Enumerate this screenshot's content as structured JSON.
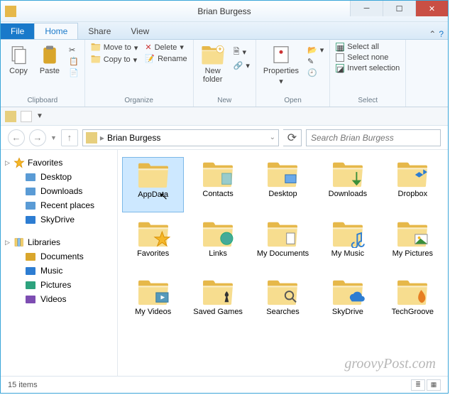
{
  "window": {
    "title": "Brian Burgess"
  },
  "tabs": {
    "file": "File",
    "items": [
      "Home",
      "Share",
      "View"
    ],
    "active": 0
  },
  "ribbon": {
    "clipboard": {
      "label": "Clipboard",
      "copy": "Copy",
      "paste": "Paste"
    },
    "organize": {
      "label": "Organize",
      "moveto": "Move to",
      "copyto": "Copy to",
      "delete": "Delete",
      "rename": "Rename"
    },
    "new": {
      "label": "New",
      "newfolder": "New\nfolder"
    },
    "open": {
      "label": "Open",
      "properties": "Properties"
    },
    "select": {
      "label": "Select",
      "all": "Select all",
      "none": "Select none",
      "invert": "Invert selection"
    }
  },
  "address": {
    "path": "Brian Burgess",
    "search_placeholder": "Search Brian Burgess"
  },
  "sidebar": {
    "favorites": {
      "label": "Favorites",
      "items": [
        "Desktop",
        "Downloads",
        "Recent places",
        "SkyDrive"
      ]
    },
    "libraries": {
      "label": "Libraries",
      "items": [
        "Documents",
        "Music",
        "Pictures",
        "Videos"
      ]
    }
  },
  "files": [
    {
      "name": "AppData",
      "selected": true,
      "badge": ""
    },
    {
      "name": "Contacts",
      "badge": "contacts"
    },
    {
      "name": "Desktop",
      "badge": "desktop"
    },
    {
      "name": "Downloads",
      "badge": "down"
    },
    {
      "name": "Dropbox",
      "badge": "dropbox"
    },
    {
      "name": "Favorites",
      "badge": "star"
    },
    {
      "name": "Links",
      "badge": "globe"
    },
    {
      "name": "My Documents",
      "badge": "doc"
    },
    {
      "name": "My Music",
      "badge": "music"
    },
    {
      "name": "My Pictures",
      "badge": "pic"
    },
    {
      "name": "My Videos",
      "badge": "video"
    },
    {
      "name": "Saved Games",
      "badge": "chess"
    },
    {
      "name": "Searches",
      "badge": "search"
    },
    {
      "name": "SkyDrive",
      "badge": "cloud"
    },
    {
      "name": "TechGroove",
      "badge": "flame"
    }
  ],
  "status": {
    "item_count": "15 items"
  },
  "watermark": "groovyPost.com",
  "colors": {
    "accent": "#1979ca",
    "folder": "#f3d16f",
    "folder_dark": "#d9a62c"
  }
}
